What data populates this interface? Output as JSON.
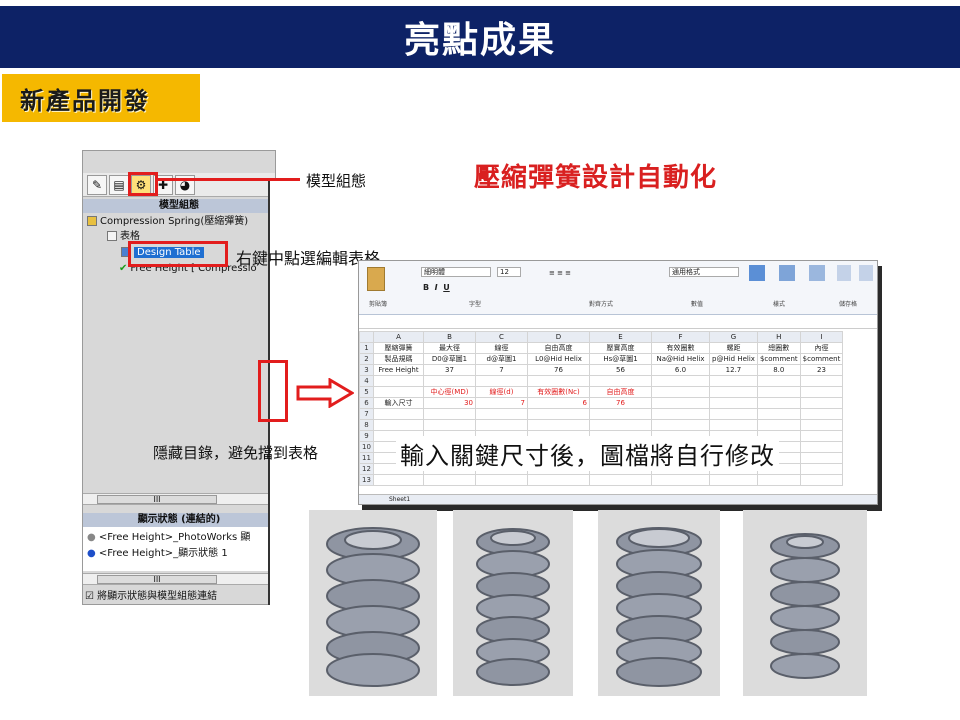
{
  "header": {
    "title": "亮點成果"
  },
  "section": {
    "label": "新產品開發"
  },
  "headline": "壓縮彈簧設計自動化",
  "annotations": {
    "model_config": "模型組態",
    "right_click": "右鍵中點選編輯表格",
    "hide_tree": "隱藏目錄，避免擋到表格",
    "input_hint": "輸入關鍵尺寸後，圖檔將自行修改"
  },
  "sw_panel": {
    "tree_heading": "模型組態",
    "root": "Compression Spring(壓縮彈簧)",
    "table_node": "表格",
    "design_table": "Design Table",
    "config": "Free Height [ Compressio",
    "display_heading": "顯示狀態 (連結的)",
    "display_items": [
      "<Free Height>_PhotoWorks 顯",
      "<Free Height>_顯示狀態 1"
    ],
    "link_option": "將顯示狀態與模型組態連結",
    "scroll_label": "III"
  },
  "excel": {
    "ribbon_groups": [
      "剪貼簿",
      "字型",
      "對齊方式",
      "數值",
      "樣式",
      "儲存格"
    ],
    "font_name": "細明體",
    "font_size": "12",
    "number_format": "通用格式",
    "columns": [
      "A",
      "B",
      "C",
      "D",
      "E",
      "F",
      "G",
      "H",
      "I"
    ],
    "rows": [
      [
        "1",
        "壓縮彈簧",
        "最大徑",
        "線徑",
        "自由高度",
        "壓實高度",
        "有效圈數",
        "螺距",
        "總圈數",
        "內徑"
      ],
      [
        "2",
        "製品規碼",
        "D0@草圖1",
        "d@草圖1",
        "L0@Hid Helix",
        "Hs@草圖1",
        "Na@Hid Helix",
        "p@Hid Helix",
        "$comment",
        "$comment"
      ],
      [
        "3",
        "Free Height",
        "37",
        "7",
        "76",
        "56",
        "6.0",
        "12.7",
        "8.0",
        "23"
      ],
      [
        "4",
        "",
        "",
        "",
        "",
        "",
        "",
        "",
        "",
        ""
      ],
      [
        "5",
        "",
        "中心徑(MD)",
        "線徑(d)",
        "有效圈數(Nc)",
        "自由高度",
        "",
        "",
        "",
        ""
      ],
      [
        "6",
        "輸入尺寸",
        "30",
        "7",
        "6",
        "76",
        "",
        "",
        "",
        ""
      ],
      [
        "7",
        "",
        "",
        "",
        "",
        "",
        "",
        "",
        "",
        ""
      ],
      [
        "8",
        "",
        "",
        "",
        "",
        "",
        "",
        "",
        "",
        ""
      ],
      [
        "9",
        "",
        "",
        "",
        "",
        "",
        "",
        "",
        "",
        ""
      ],
      [
        "10",
        "",
        "",
        "",
        "",
        "",
        "",
        "",
        "",
        ""
      ],
      [
        "11",
        "",
        "",
        "",
        "",
        "",
        "",
        "",
        "",
        ""
      ],
      [
        "12",
        "",
        "",
        "",
        "",
        "",
        "",
        "",
        "",
        ""
      ],
      [
        "13",
        "",
        "",
        "",
        "",
        "",
        "",
        "",
        "",
        ""
      ]
    ],
    "sheet_tab": "Sheet1"
  },
  "colors": {
    "title_bg": "#0d2266",
    "tag_bg": "#f5b800",
    "accent_red": "#e21d1d"
  }
}
